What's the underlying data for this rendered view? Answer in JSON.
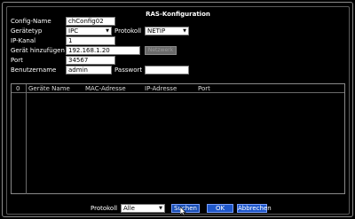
{
  "dialog": {
    "title": "RAS-Konfiguration"
  },
  "form": {
    "config_name_label": "Config-Name",
    "config_name_value": "chConfig02",
    "device_type_label": "Gerätetyp",
    "device_type_value": "IPC",
    "protocol_label": "Protokoll",
    "protocol_value": "NETIP",
    "ip_channel_label": "IP-Kanal",
    "ip_channel_value": "1",
    "add_device_label": "Gerät hinzufügen",
    "add_device_value": "192.168.1.20",
    "network_button": "Netzwerk",
    "port_label": "Port",
    "port_value": "34567",
    "username_label": "Benutzername",
    "username_value": "admin",
    "password_label": "Passwort",
    "password_value": ""
  },
  "device_list": {
    "columns": [
      "0",
      "Geräte Name",
      "MAC-Adresse",
      "IP-Adresse",
      "Port"
    ]
  },
  "footer": {
    "protocol_label": "Protokoll",
    "protocol_value": "Alle",
    "search_button": "Suchen",
    "ok_button": "OK",
    "cancel_button": "Abbrechen"
  },
  "icons": {
    "dropdown": "chevron-down-icon",
    "cursor": "mouse-pointer-icon"
  },
  "colors": {
    "button_blue": "#1f57c9",
    "background": "#000000"
  }
}
